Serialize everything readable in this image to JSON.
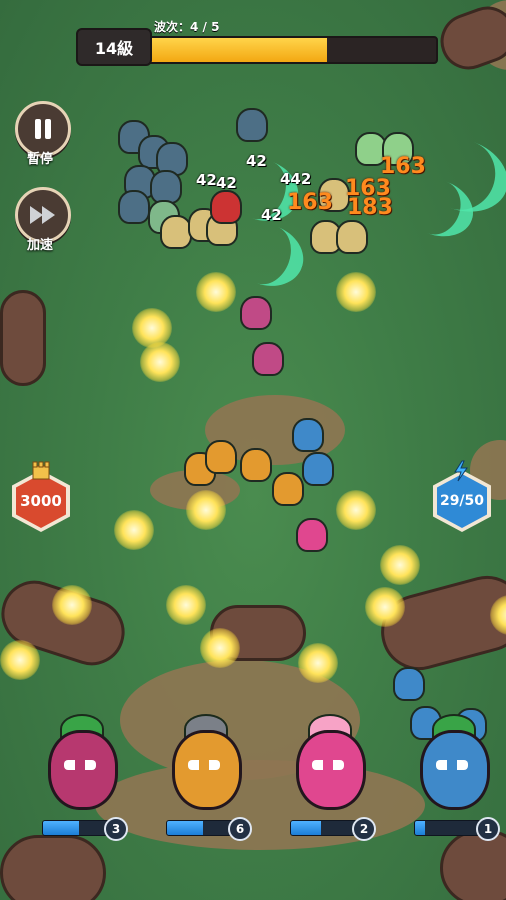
{
  "hud": {
    "level": "14級",
    "wave_label": "波次：4 / 5",
    "wave_progress": 0.62
  },
  "buttons": {
    "pause_label": "暫停",
    "speed_label": "加速"
  },
  "base_hp": "3000",
  "energy": "29/50",
  "damage_numbers": [
    "42",
    "42",
    "42",
    "42",
    "442",
    "163",
    "163",
    "183",
    "163"
  ],
  "heroes": [
    {
      "name": "radish",
      "level": "3",
      "fill": 0.55,
      "color": "#b7386f",
      "leaf": "#39a447"
    },
    {
      "name": "robot",
      "level": "6",
      "fill": 0.55,
      "color": "#e39a2f",
      "leaf": "#7b8088"
    },
    {
      "name": "dragonfruit",
      "level": "2",
      "fill": 0.45,
      "color": "#e0478f",
      "leaf": "#f7a3c6"
    },
    {
      "name": "blueberry",
      "level": "1",
      "fill": 0.15,
      "color": "#3f89c9",
      "leaf": "#39a447"
    }
  ],
  "colors": {
    "grass": "#3f7d47",
    "dirt": "#8f7552",
    "progress": "#f3a812",
    "hp_badge": "#d94a2e",
    "energy_badge": "#2f8ad6"
  }
}
